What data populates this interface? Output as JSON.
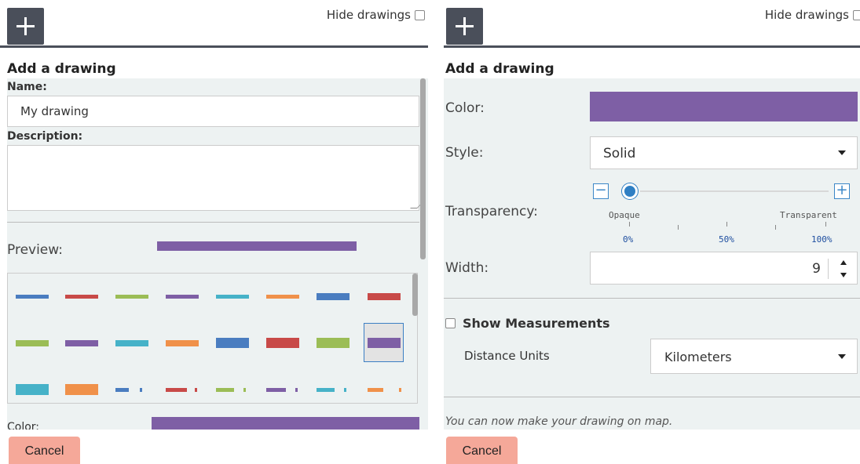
{
  "left": {
    "hide_drawings_label": "Hide drawings",
    "title": "Add a drawing",
    "name_label": "Name:",
    "name_value": "My drawing",
    "description_label": "Description:",
    "preview_label": "Preview:",
    "bottom_label_partial": "Color:",
    "cancel_label": "Cancel",
    "colors": {
      "blue": "#4a7dc0",
      "red": "#c84a48",
      "green": "#9bbd56",
      "purple": "#7e5fa5",
      "cyan": "#46b2c8",
      "orange": "#f0914a"
    }
  },
  "right": {
    "hide_drawings_label": "Hide drawings",
    "title": "Add a drawing",
    "color_label": "Color:",
    "color_value": "#7e5fa5",
    "style_label": "Style:",
    "style_value": "Solid",
    "transparency_label": "Transparency:",
    "transparency": {
      "value": 0,
      "minus_label": "−",
      "plus_label": "+",
      "opaque_label": "Opaque",
      "transparent_label": "Transparent",
      "ticks": [
        "0%",
        "50%",
        "100%"
      ]
    },
    "width_label": "Width:",
    "width_value": "9",
    "show_measurements_label": "Show Measurements",
    "distance_units_label": "Distance Units",
    "distance_units_value": "Kilometers",
    "hint_text": "You can now make your drawing on map.",
    "cancel_label": "Cancel"
  }
}
